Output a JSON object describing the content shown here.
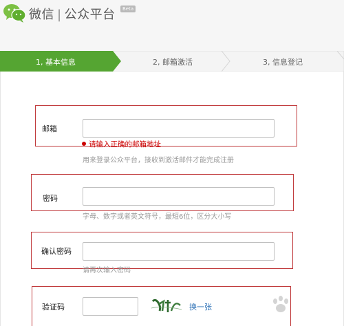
{
  "header": {
    "brand_name": "微信",
    "separator": "|",
    "platform_name": "公众平台",
    "beta_badge": "Beta",
    "logo_icon": "wechat-logo-icon"
  },
  "steps": [
    {
      "label": "1, 基本信息",
      "active": true
    },
    {
      "label": "2, 邮箱激活",
      "active": false
    },
    {
      "label": "3, 信息登记",
      "active": false
    }
  ],
  "form": {
    "email": {
      "label": "邮箱",
      "value": "",
      "error": "请输入正确的邮箱地址",
      "hint": "用来登录公众平台，接收到激活邮件才能完成注册"
    },
    "password": {
      "label": "密码",
      "value": "",
      "hint": "字母、数字或者英文符号，最短6位，区分大小写"
    },
    "confirm_password": {
      "label": "确认密码",
      "value": "",
      "hint": "请再次输入密码"
    },
    "captcha": {
      "label": "验证码",
      "value": "",
      "refresh_label": "换一张"
    }
  },
  "colors": {
    "active_step": "#55a532",
    "highlight_box": "#c0393b",
    "error": "#cc0000",
    "link": "#2a6fb5"
  }
}
